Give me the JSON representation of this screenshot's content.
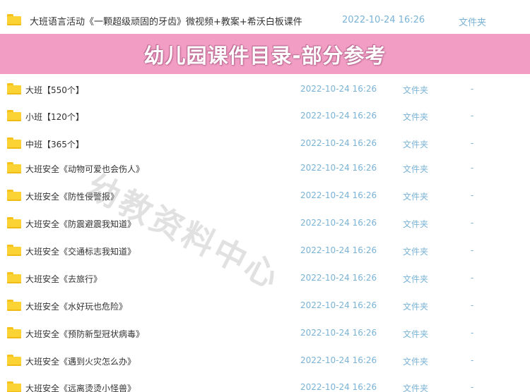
{
  "top_item": {
    "name": "大班语言活动《一颗超级顽固的牙齿》微视频+教案+希沃白板课件",
    "date": "2022-10-24 16:26",
    "type": "文件夹",
    "icon": "folder-icon"
  },
  "banner": {
    "title": "幼儿园课件目录-部分参考",
    "background": "#f29ec4"
  },
  "watermark": "幼教资料中心",
  "files": [
    {
      "name": "大班【550个】",
      "date": "2022-10-24 16:26",
      "type": "文件夹",
      "size": "-"
    },
    {
      "name": "小班【120个】",
      "date": "2022-10-24 16:26",
      "type": "文件夹",
      "size": "-"
    },
    {
      "name": "中班【365个】",
      "date": "2022-10-24 16:26",
      "type": "文件夹",
      "size": "-"
    },
    {
      "name": "大班安全《动物可爱也会伤人》",
      "date": "2022-10-24 16:26",
      "type": "文件夹",
      "size": "-"
    },
    {
      "name": "大班安全《防性侵警报》",
      "date": "2022-10-24 16:26",
      "type": "文件夹",
      "size": "-"
    },
    {
      "name": "大班安全《防震避震我知道》",
      "date": "2022-10-24 16:26",
      "type": "文件夹",
      "size": "-"
    },
    {
      "name": "大班安全《交通标志我知道》",
      "date": "2022-10-24 16:26",
      "type": "文件夹",
      "size": "-"
    },
    {
      "name": "大班安全《去旅行》",
      "date": "2022-10-24 16:26",
      "type": "文件夹",
      "size": "-"
    },
    {
      "name": "大班安全《水好玩也危险》",
      "date": "2022-10-24 16:26",
      "type": "文件夹",
      "size": "-"
    },
    {
      "name": "大班安全《预防新型冠状病毒》",
      "date": "2022-10-24 16:26",
      "type": "文件夹",
      "size": "-"
    },
    {
      "name": "大班安全《遇到火灾怎么办》",
      "date": "2022-10-24 16:26",
      "type": "文件夹",
      "size": "-"
    },
    {
      "name": "大班安全《远离烫烫小怪兽》",
      "date": "2022-10-24 16:26",
      "type": "文件夹",
      "size": "-"
    }
  ]
}
